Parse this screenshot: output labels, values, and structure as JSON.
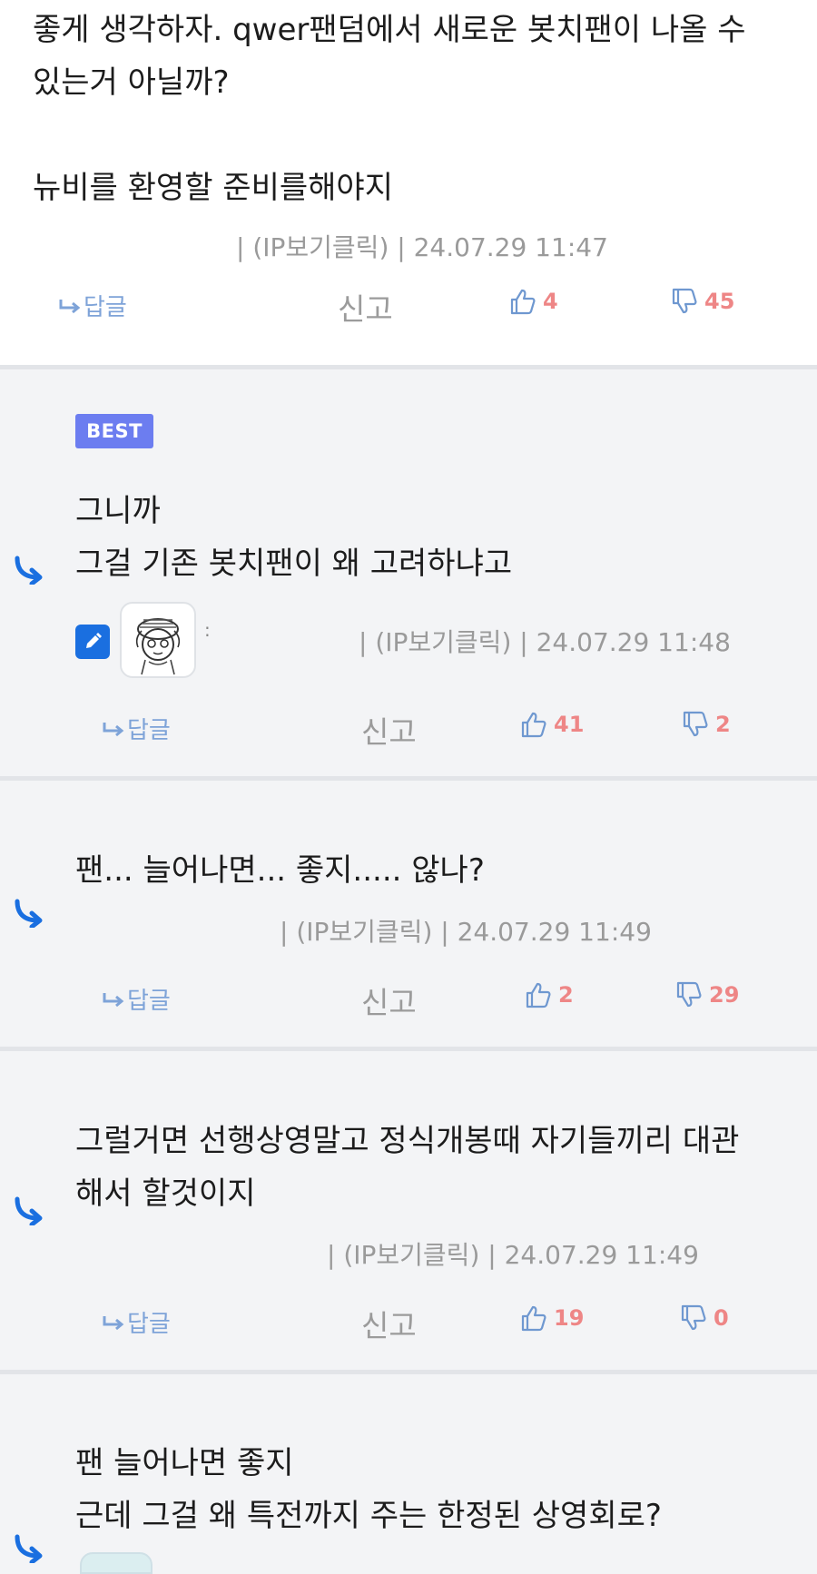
{
  "comments": [
    {
      "text": "좋게 생각하자. qwer팬덤에서 새로운 봇치팬이 나올 수\n있는거 아닐까?\n\n뉴비를 환영할 준비를해야지",
      "meta": "| (IP보기클릭) | 24.07.29 11:47",
      "reply_label": "답글",
      "report_label": "신고",
      "likes": "4",
      "dislikes": "45"
    },
    {
      "badge": "BEST",
      "text": "그니까\n그걸 기존 봇치팬이 왜 고려하냐고",
      "colon": ":",
      "meta": "| (IP보기클릭) | 24.07.29 11:48",
      "reply_label": "답글",
      "report_label": "신고",
      "likes": "41",
      "dislikes": "2"
    },
    {
      "text": "팬... 늘어나면... 좋지..... 않나?",
      "meta": "| (IP보기클릭) | 24.07.29 11:49",
      "reply_label": "답글",
      "report_label": "신고",
      "likes": "2",
      "dislikes": "29"
    },
    {
      "text": "그럴거면 선행상영말고 정식개봉때 자기들끼리 대관\n해서 할것이지",
      "meta": "| (IP보기클릭) | 24.07.29 11:49",
      "reply_label": "답글",
      "report_label": "신고",
      "likes": "19",
      "dislikes": "0"
    },
    {
      "text": "팬 늘어나면 좋지\n근데 그걸 왜 특전까지 주는 한정된 상영회로?"
    }
  ],
  "colors": {
    "accent": "#1a6fe0",
    "vote": "#ee8686",
    "reply": "#7ea3d8",
    "best": "#6c7df0"
  }
}
